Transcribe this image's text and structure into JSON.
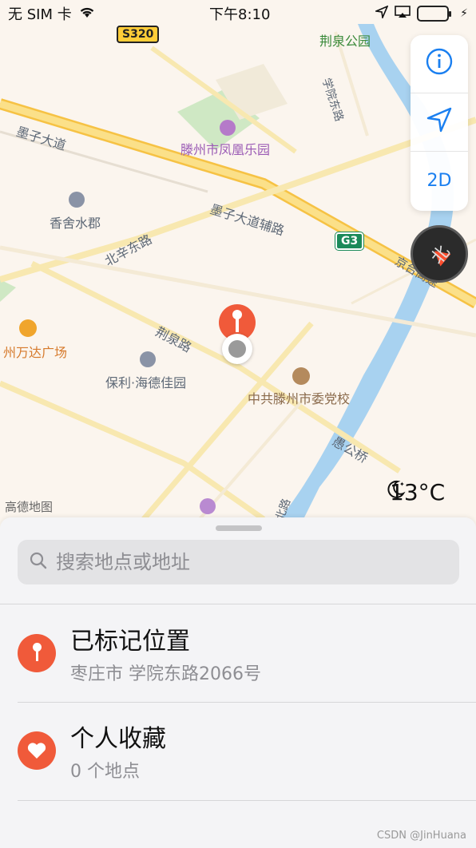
{
  "status": {
    "carrier": "无 SIM 卡",
    "time": "下午8:10"
  },
  "map": {
    "road_labels": {
      "mozi_avenue": "墨子大道",
      "beixin_east_road": "北辛东路",
      "mozi_avenue_aux": "墨子大道辅路",
      "jingquan_road": "荆泉路",
      "xueyuan_east_road": "学院东路",
      "jingtai_expressway": "京台高速",
      "yugong_bridge": "愚公桥",
      "bei_road_fragment": "北路"
    },
    "poi_labels": {
      "phoenix_park": "滕州市凤凰乐园",
      "xiangshe_shuijun": "香舍水郡",
      "wanda_plaza": "州万达广场",
      "poly_haide": "保利·海德佳园",
      "party_school": "中共滕州市委党校",
      "jingquan_park": "荆泉公园"
    },
    "highway_badges": {
      "s320": "S320",
      "g3": "G3"
    },
    "provider_logo": "高德地图",
    "weather": {
      "temperature": "13°C",
      "icon": "moon-icon"
    }
  },
  "controls": {
    "info_icon": "ⓘ",
    "mode_label": "2D",
    "compass_label": "北"
  },
  "sheet": {
    "search_placeholder": "搜索地点或地址",
    "items": [
      {
        "title": "已标记位置",
        "subtitle": "枣庄市 学院东路2066号",
        "icon": "pin-icon",
        "color": "#f05a3a"
      },
      {
        "title": "个人收藏",
        "subtitle": "0 个地点",
        "icon": "heart-icon",
        "color": "#f05a3a"
      }
    ]
  },
  "watermark": "CSDN @JinHuana"
}
